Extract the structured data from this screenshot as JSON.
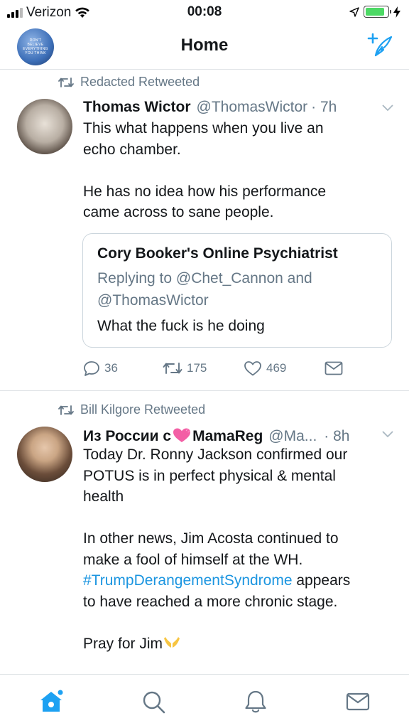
{
  "status_bar": {
    "carrier": "Verizon",
    "time": "00:08",
    "battery_level": 0.85
  },
  "header": {
    "title": "Home",
    "avatar_text": "DON'T BELIEVE EVERYTHING YOU THINK",
    "avatar_icon": "profile-avatar",
    "compose_icon": "compose-tweet-icon"
  },
  "tweets": [
    {
      "retweeted_by": "Redacted Retweeted",
      "name": "Thomas Wictor",
      "handle": "@ThomasWictor",
      "time": "· 7h",
      "body": [
        "This what happens when you live an",
        "echo chamber.",
        "",
        "He has no idea how his performance",
        "came across to sane people."
      ],
      "quote": {
        "name": "Cory Booker's Online Psychiatrist",
        "reply_line1": "Replying to @Chet_Cannon and",
        "reply_line2": "@ThomasWictor",
        "text": "What the fuck is he doing"
      },
      "actions": {
        "replies": "36",
        "retweets": "175",
        "likes": "469"
      }
    },
    {
      "retweeted_by": "Bill Kilgore Retweeted",
      "name_prefix": "Из России с",
      "name_emoji": "💓",
      "name_suffix": "MamaReg",
      "handle": "@Ma...",
      "time": "· 8h",
      "body": [
        "Today Dr. Ronny Jackson confirmed our",
        "POTUS is in perfect physical & mental",
        "health",
        "",
        "In other news, Jim Acosta continued to",
        "make a fool of himself at the WH."
      ],
      "hashtag": "#TrumpDerangementSyndrome",
      "after_hashtag": " appears",
      "body_cont": [
        "to have reached a more chronic stage.",
        ""
      ],
      "last_line": "Pray for Jim",
      "last_emoji": "👐"
    }
  ],
  "tab_bar": {
    "tabs": [
      "home-icon",
      "search-icon",
      "notifications-icon",
      "messages-icon"
    ],
    "active_color": "#1da1f2",
    "inactive_color": "#657786"
  }
}
